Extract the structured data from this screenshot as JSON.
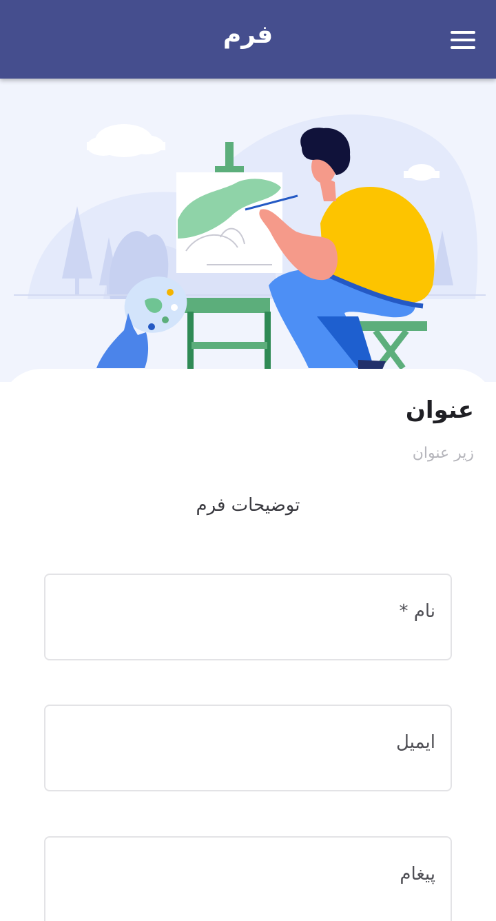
{
  "app_bar": {
    "title": "فرم",
    "menu_icon": "hamburger-menu-icon"
  },
  "hero": {
    "illustration": "artist-painting-at-easel-illustration"
  },
  "form": {
    "title": "عنوان",
    "subtitle": "زیر عنوان",
    "description": "توضیحات فرم",
    "fields": [
      {
        "label": "نام *"
      },
      {
        "label": "ایمیل"
      },
      {
        "label": "پیغام"
      }
    ]
  },
  "colors": {
    "app_bar": "#454e8e",
    "hero_background": "#f1f4fd",
    "shirt": "#fdc400",
    "pants": "#4d8ff5",
    "easel": "#5cae7b"
  }
}
